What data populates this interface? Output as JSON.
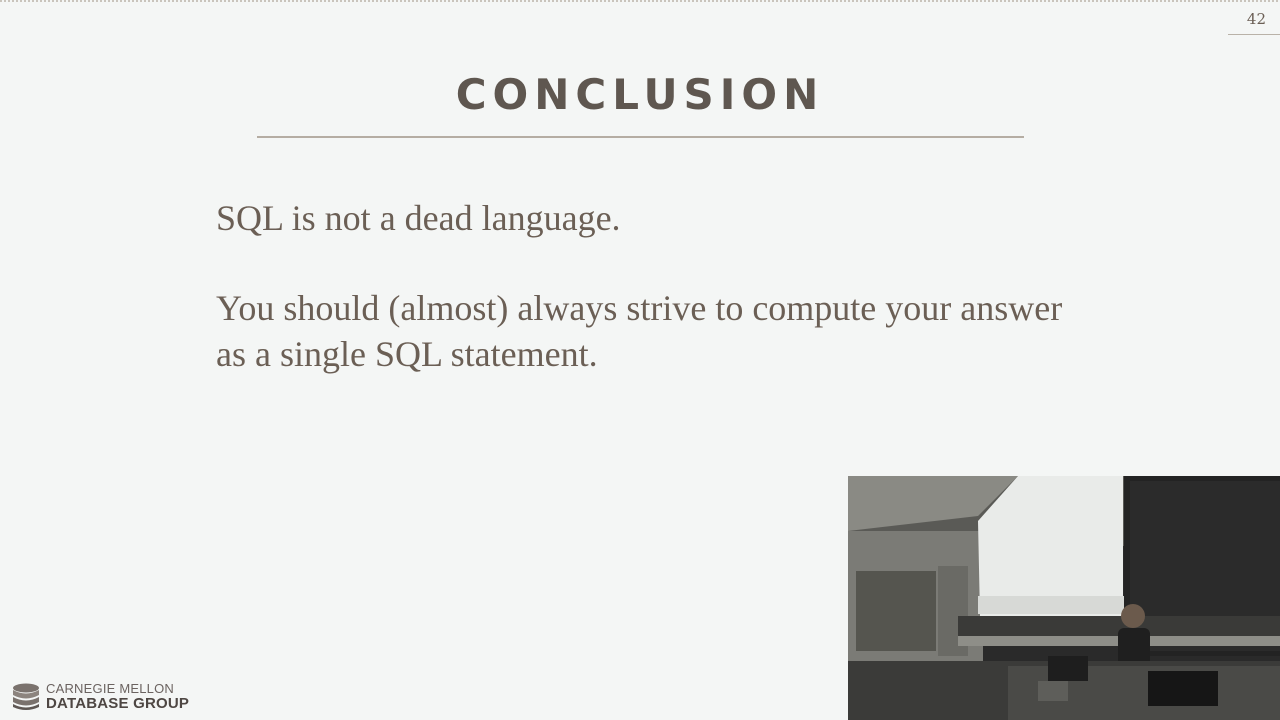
{
  "slide": {
    "page_number": "42",
    "title": "CONCLUSION",
    "bullets": [
      "SQL is not a dead language.",
      "You should (almost) always strive to compute your answer as a single SQL statement."
    ]
  },
  "logo": {
    "line1": "CARNEGIE MELLON",
    "line2": "DATABASE GROUP"
  },
  "colors": {
    "background": "#f4f6f5",
    "text": "#6b5f55",
    "title": "#5f5750",
    "rule": "#b5ada3"
  },
  "video_overlay": {
    "icon": "lecture-camera-feed"
  }
}
